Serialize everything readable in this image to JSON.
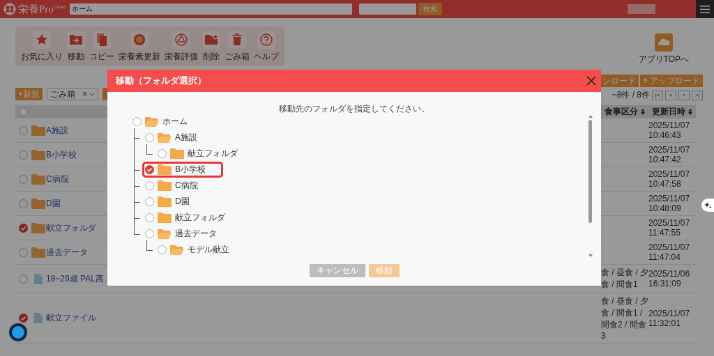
{
  "header": {
    "logo": "栄養Pro$^{Cloud}$",
    "search_value": "ホーム",
    "search_button": "検索"
  },
  "toolbar": [
    {
      "kind": "favorite",
      "label": "お気に入り"
    },
    {
      "kind": "move",
      "label": "移動"
    },
    {
      "kind": "copy",
      "label": "コピー"
    },
    {
      "kind": "nutrient",
      "label": "栄養素更新"
    },
    {
      "kind": "evaluate",
      "label": "栄養評価"
    },
    {
      "kind": "delete",
      "label": "削除"
    },
    {
      "kind": "trash",
      "label": "ごみ箱"
    },
    {
      "kind": "help",
      "label": "ヘルプ"
    }
  ],
  "app_top": {
    "label": "アプリTOPへ"
  },
  "actions": {
    "new_button": "+新規",
    "filter": {
      "value": "ごみ箱",
      "clear": "×"
    },
    "download_button": "ンロード",
    "upload_button": "アップロード"
  },
  "pagination": {
    "summary": "~8件 / 8件",
    "buttons": [
      "|<",
      "<",
      ">",
      ">|"
    ]
  },
  "table": {
    "select_all": {
      "checked": false
    },
    "columns": [
      "食事区分",
      "更新日時"
    ],
    "rows": [
      {
        "checked": false,
        "kind": "folder",
        "name": "A施設",
        "updated": "2025/11/07 10:46:43"
      },
      {
        "checked": false,
        "kind": "folder",
        "name": "B小学校",
        "updated": "2025/11/07 10:47:42"
      },
      {
        "checked": false,
        "kind": "folder",
        "name": "C病院",
        "updated": "2025/11/07 10:47:58"
      },
      {
        "checked": false,
        "kind": "folder",
        "name": "D園",
        "updated": "2025/11/07 10:48:09"
      },
      {
        "checked": true,
        "kind": "folder",
        "name": "献立フォルダ",
        "updated": "2025/11/07 11:47:55"
      },
      {
        "checked": false,
        "kind": "folder",
        "name": "過去データ",
        "updated": "2025/11/07 11:47:04"
      },
      {
        "checked": false,
        "kind": "file",
        "name": "18~29歳 PAL高",
        "meal": "食 / 昼食 / 夕食 / 間食1",
        "updated": "2025/11/06 16:31:09"
      },
      {
        "checked": true,
        "kind": "file",
        "name": "献立ファイル",
        "meal": "食 / 昼食 / 夕食 / 間食1 / 間食2 / 間食3",
        "updated": "2025/11/07 11:32:01"
      }
    ]
  },
  "dialog": {
    "title": "移動（フォルダ選択）",
    "instruction": "移動先のフォルダを指定してください。",
    "tree": [
      {
        "label": "ホーム",
        "selected": false,
        "expanded": true,
        "children": [
          {
            "label": "A施設",
            "selected": false,
            "expanded": true,
            "children": [
              {
                "label": "献立フォルダ",
                "selected": false,
                "expanded": false
              }
            ]
          },
          {
            "label": "B小学校",
            "selected": true,
            "expanded": false
          },
          {
            "label": "C病院",
            "selected": false,
            "expanded": false
          },
          {
            "label": "D園",
            "selected": false,
            "expanded": false
          },
          {
            "label": "献立フォルダ",
            "selected": false,
            "expanded": false
          },
          {
            "label": "過去データ",
            "selected": false,
            "expanded": true,
            "children": [
              {
                "label": "モデル献立",
                "selected": false,
                "expanded": true
              }
            ]
          }
        ]
      }
    ],
    "buttons": [
      {
        "kind": "cancel",
        "label": "キャンセル",
        "disabled": false
      },
      {
        "kind": "primary",
        "label": "移動",
        "disabled": true
      }
    ]
  }
}
